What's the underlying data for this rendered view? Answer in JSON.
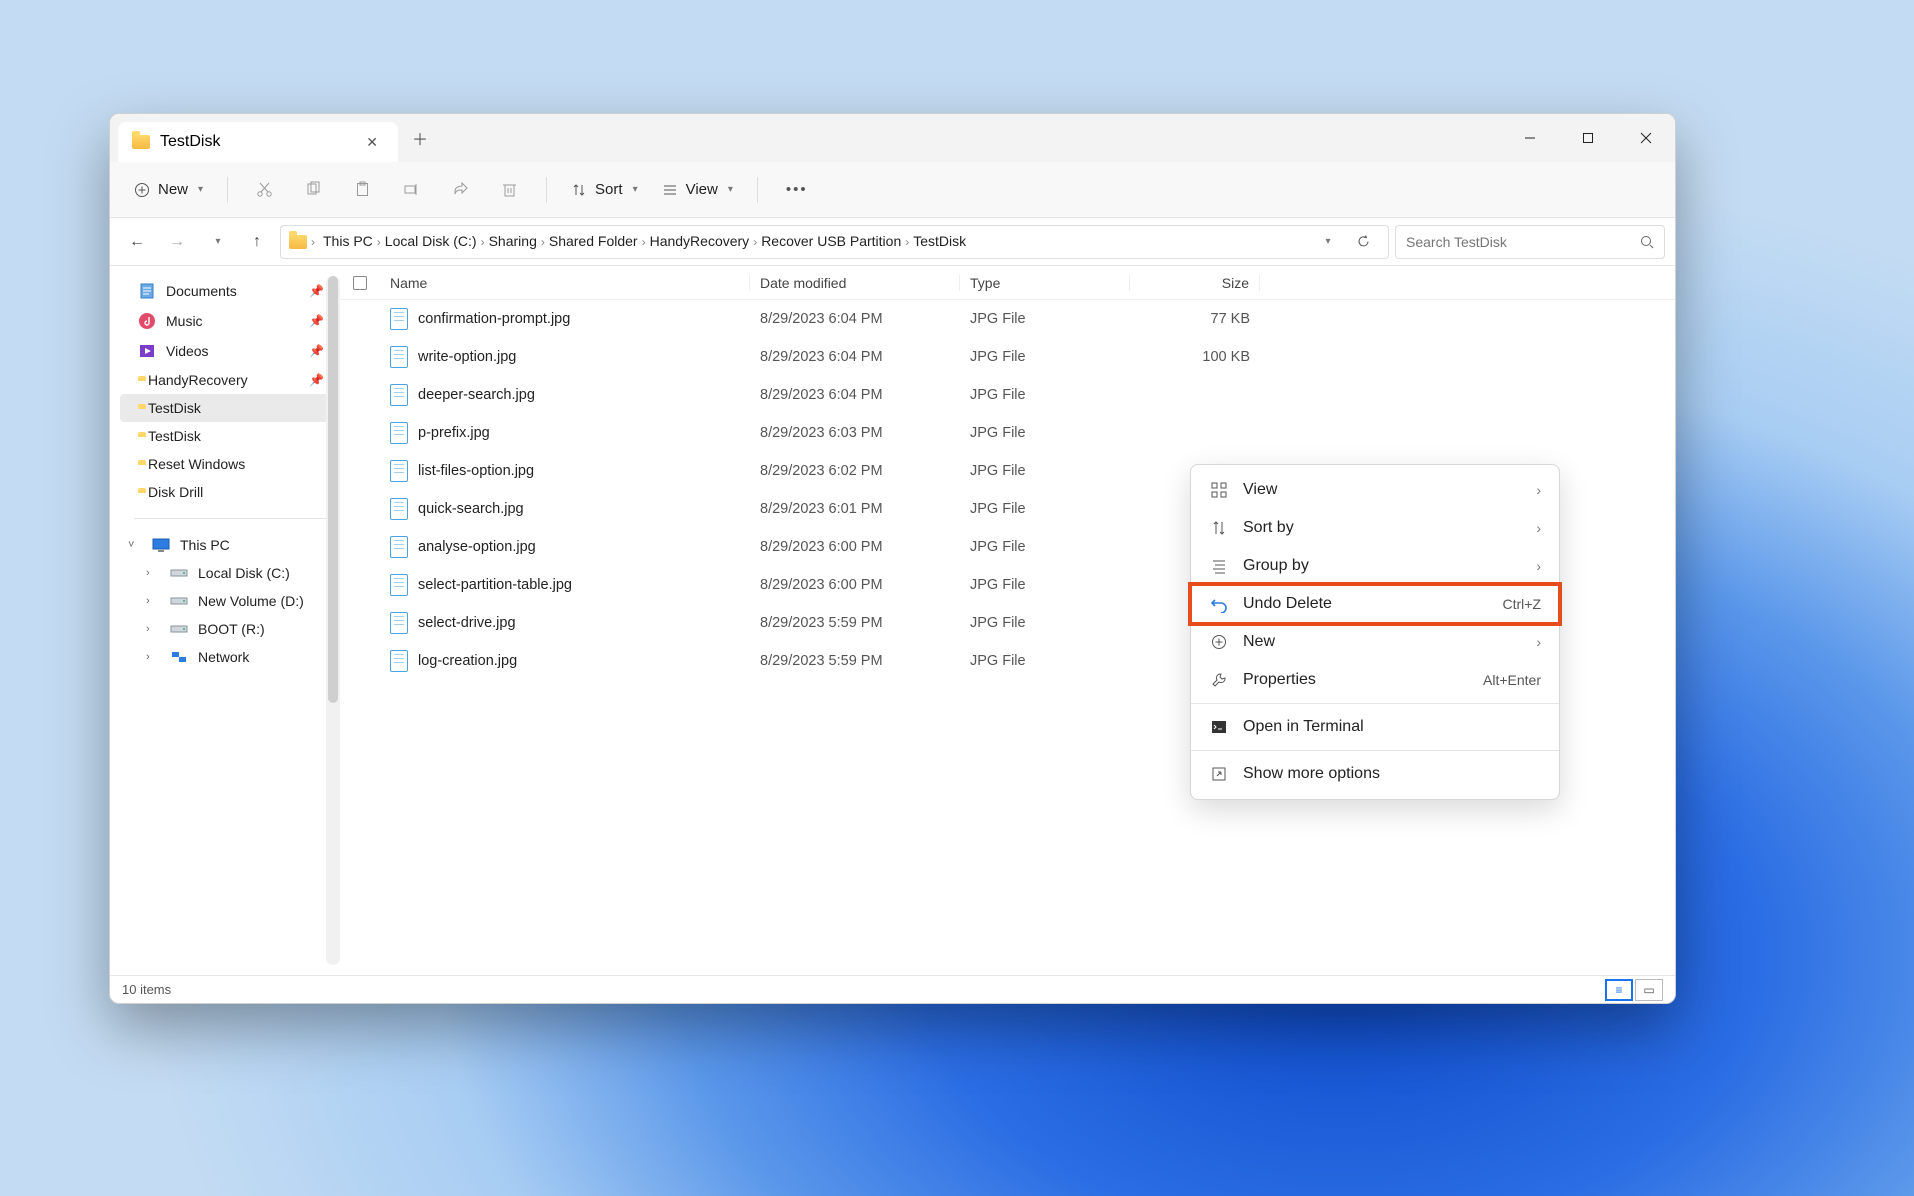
{
  "tab": {
    "title": "TestDisk"
  },
  "window_controls": {
    "minimize": "–",
    "maximize": "▢",
    "close": "✕"
  },
  "toolbar": {
    "new_label": "New",
    "sort_label": "Sort",
    "view_label": "View"
  },
  "breadcrumb": [
    "This PC",
    "Local Disk (C:)",
    "Sharing",
    "Shared Folder",
    "HandyRecovery",
    "Recover USB Partition",
    "TestDisk"
  ],
  "search": {
    "placeholder": "Search TestDisk"
  },
  "sidebar": {
    "quick": [
      {
        "label": "Documents",
        "icon": "documents",
        "pinned": true
      },
      {
        "label": "Music",
        "icon": "music",
        "pinned": true
      },
      {
        "label": "Videos",
        "icon": "videos",
        "pinned": true
      },
      {
        "label": "HandyRecovery",
        "icon": "folder",
        "pinned": true
      },
      {
        "label": "TestDisk",
        "icon": "folder",
        "pinned": false,
        "selected": true
      },
      {
        "label": "TestDisk",
        "icon": "folder",
        "pinned": false
      },
      {
        "label": "Reset Windows",
        "icon": "folder",
        "pinned": false
      },
      {
        "label": "Disk Drill",
        "icon": "folder",
        "pinned": false
      }
    ],
    "this_pc_label": "This PC",
    "drives": [
      {
        "label": "Local Disk (C:)"
      },
      {
        "label": "New Volume (D:)"
      },
      {
        "label": "BOOT (R:)"
      }
    ],
    "network_label": "Network"
  },
  "columns": {
    "name": "Name",
    "date": "Date modified",
    "type": "Type",
    "size": "Size"
  },
  "files": [
    {
      "name": "confirmation-prompt.jpg",
      "date": "8/29/2023 6:04 PM",
      "type": "JPG File",
      "size": "77 KB"
    },
    {
      "name": "write-option.jpg",
      "date": "8/29/2023 6:04 PM",
      "type": "JPG File",
      "size": "100 KB"
    },
    {
      "name": "deeper-search.jpg",
      "date": "8/29/2023 6:04 PM",
      "type": "JPG File",
      "size": ""
    },
    {
      "name": "p-prefix.jpg",
      "date": "8/29/2023 6:03 PM",
      "type": "JPG File",
      "size": ""
    },
    {
      "name": "list-files-option.jpg",
      "date": "8/29/2023 6:02 PM",
      "type": "JPG File",
      "size": ""
    },
    {
      "name": "quick-search.jpg",
      "date": "8/29/2023 6:01 PM",
      "type": "JPG File",
      "size": ""
    },
    {
      "name": "analyse-option.jpg",
      "date": "8/29/2023 6:00 PM",
      "type": "JPG File",
      "size": ""
    },
    {
      "name": "select-partition-table.jpg",
      "date": "8/29/2023 6:00 PM",
      "type": "JPG File",
      "size": ""
    },
    {
      "name": "select-drive.jpg",
      "date": "8/29/2023 5:59 PM",
      "type": "JPG File",
      "size": ""
    },
    {
      "name": "log-creation.jpg",
      "date": "8/29/2023 5:59 PM",
      "type": "JPG File",
      "size": ""
    }
  ],
  "context_menu": [
    {
      "icon": "grid",
      "label": "View",
      "submenu": true
    },
    {
      "icon": "sort",
      "label": "Sort by",
      "submenu": true
    },
    {
      "icon": "group",
      "label": "Group by",
      "submenu": true
    },
    {
      "icon": "undo",
      "label": "Undo Delete",
      "shortcut": "Ctrl+Z",
      "highlight": true
    },
    {
      "icon": "plus",
      "label": "New",
      "submenu": true
    },
    {
      "icon": "wrench",
      "label": "Properties",
      "shortcut": "Alt+Enter"
    },
    {
      "sep": true
    },
    {
      "icon": "terminal",
      "label": "Open in Terminal"
    },
    {
      "sep": true
    },
    {
      "icon": "expand",
      "label": "Show more options"
    }
  ],
  "status": {
    "text": "10 items"
  }
}
